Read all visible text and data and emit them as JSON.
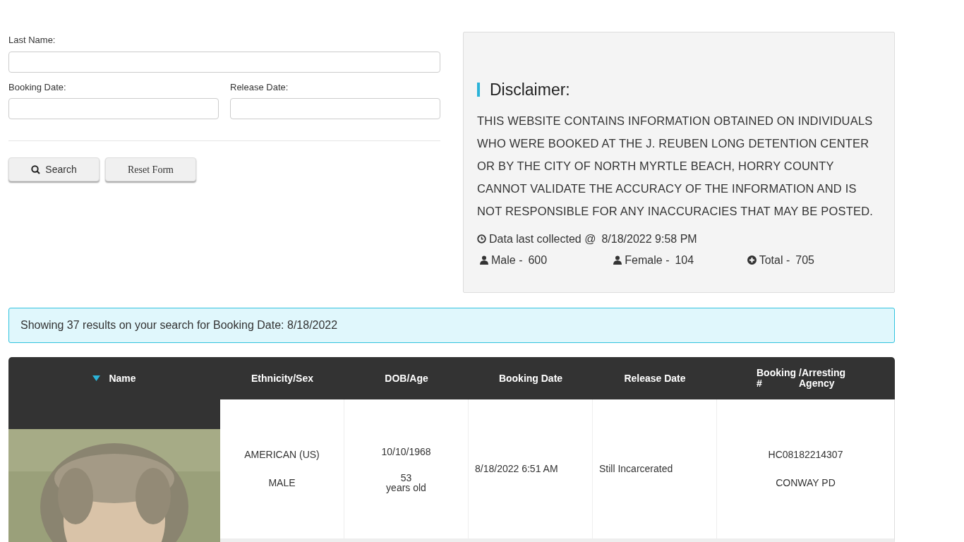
{
  "search_form": {
    "last_name": {
      "label": "Last Name:"
    },
    "booking_date": {
      "label": "Booking Date:"
    },
    "release_date": {
      "label": "Release Date:"
    },
    "buttons": [
      {
        "kind": "search",
        "label": "Search"
      },
      {
        "kind": "reset",
        "label": "Reset Form"
      }
    ]
  },
  "disclaimer": {
    "title": "Disclaimer:",
    "text": "THIS WEBSITE CONTAINS INFORMATION OBTAINED ON INDIVIDUALS WHO WERE BOOKED AT THE J. REUBEN LONG DETENTION CENTER OR BY THE CITY OF NORTH MYRTLE BEACH, HORRY COUNTY CANNOT VALIDATE THE ACCURACY OF THE INFORMATION AND IS NOT RESPONSIBLE FOR ANY INACCURACIES THAT MAY BE POSTED.",
    "last_collected": {
      "label": "Data last collected @",
      "value": "8/18/2022 9:58 PM"
    },
    "stats": [
      {
        "kind": "person",
        "label": "Male -",
        "value": "600"
      },
      {
        "kind": "person",
        "label": "Female -",
        "value": "104"
      },
      {
        "kind": "total",
        "label": "Total -",
        "value": "705"
      }
    ]
  },
  "results_alert": "Showing 37 results on your search for Booking Date: 8/18/2022",
  "table": {
    "columns": [
      {
        "label": "Name",
        "sorted": true
      },
      {
        "label": "Ethnicity/Sex",
        "sorted": false
      },
      {
        "label": "DOB/Age",
        "sorted": false
      },
      {
        "label": "Booking Date",
        "sorted": false
      },
      {
        "label": "Release Date",
        "sorted": false
      },
      {
        "label": "Booking #",
        "label_2": "/Arresting Agency",
        "sorted": false
      }
    ],
    "rows": [
      {
        "ethnicity": "AMERICAN (US)",
        "sex": "MALE",
        "dob": "10/10/1968",
        "age": "53",
        "age_unit": "years old",
        "booking_date": "8/18/2022 6:51 AM",
        "release_date": "Still Incarcerated",
        "booking_number": "HC08182214307",
        "agency": "CONWAY PD"
      }
    ]
  }
}
